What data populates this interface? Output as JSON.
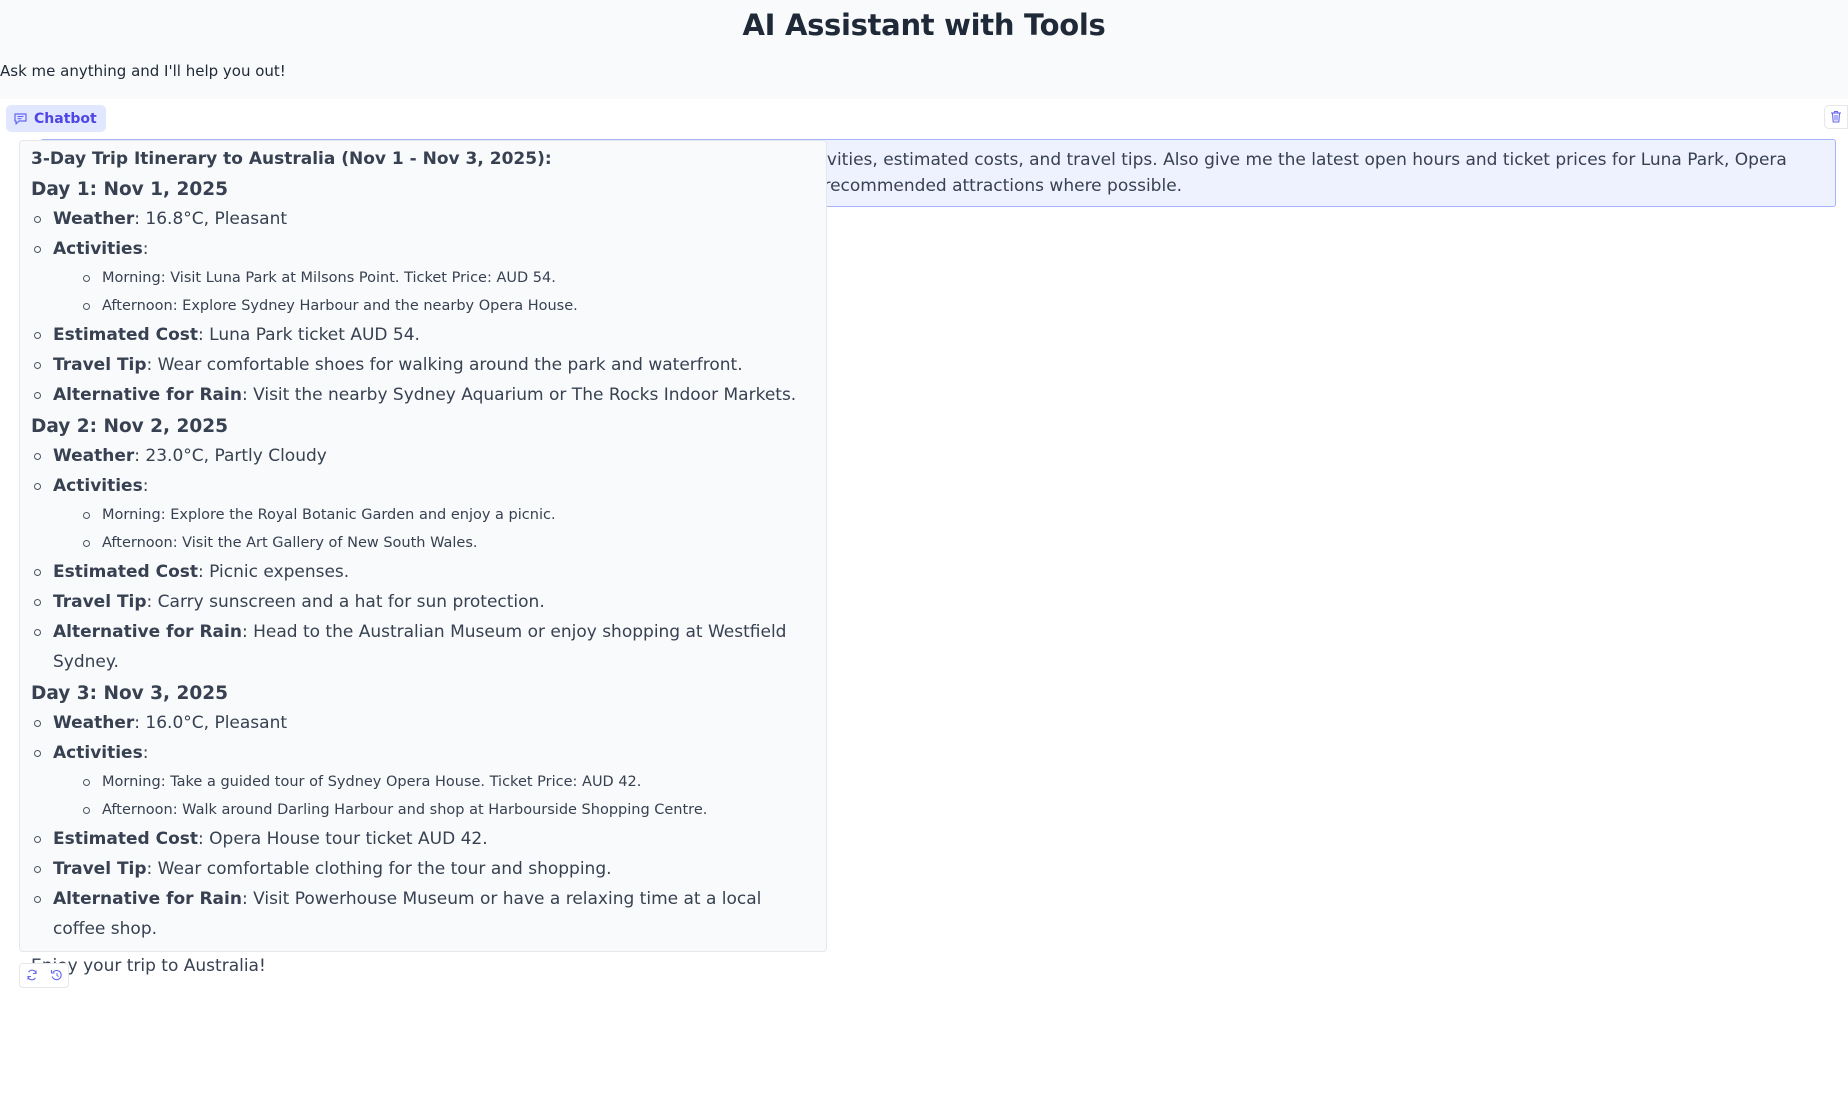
{
  "app": {
    "title": "AI Assistant with Tools",
    "subtitle": "Ask me anything and I'll help you out!"
  },
  "chatbot": {
    "label": "Chatbot",
    "label_icon": "chat-icon",
    "clear_icon": "trash-icon",
    "accent_color": "#4f46e5"
  },
  "messages": {
    "user": {
      "text": "Plan me a 3-day trip to Australia (Nov 1 – Nov 3, 2025). Include day-wise itinerary with activities, estimated costs, and travel tips. Also give me the latest open hours and ticket prices for Luna Park, Opera House the expected weather during those dates, and suggest alternatives if it rains. Book recommended attractions where possible."
    },
    "bot": {
      "heading": "3-Day Trip Itinerary to Australia (Nov 1 - Nov 3, 2025):",
      "days": [
        {
          "title": "Day 1: Nov 1, 2025",
          "weather_label": "Weather",
          "weather": ": 16.8°C, Pleasant",
          "activities_label": "Activities",
          "activities_suffix": ":",
          "activities": [
            "Morning: Visit Luna Park at Milsons Point. Ticket Price: AUD 54.",
            "Afternoon: Explore Sydney Harbour and the nearby Opera House."
          ],
          "cost_label": "Estimated Cost",
          "cost": ": Luna Park ticket AUD 54.",
          "tip_label": "Travel Tip",
          "tip": ": Wear comfortable shoes for walking around the park and waterfront.",
          "rain_label": "Alternative for Rain",
          "rain": ": Visit the nearby Sydney Aquarium or The Rocks Indoor Markets."
        },
        {
          "title": "Day 2: Nov 2, 2025",
          "weather_label": "Weather",
          "weather": ": 23.0°C, Partly Cloudy",
          "activities_label": "Activities",
          "activities_suffix": ":",
          "activities": [
            "Morning: Explore the Royal Botanic Garden and enjoy a picnic.",
            "Afternoon: Visit the Art Gallery of New South Wales."
          ],
          "cost_label": "Estimated Cost",
          "cost": ": Picnic expenses.",
          "tip_label": "Travel Tip",
          "tip": ": Carry sunscreen and a hat for sun protection.",
          "rain_label": "Alternative for Rain",
          "rain": ": Head to the Australian Museum or enjoy shopping at Westfield Sydney."
        },
        {
          "title": "Day 3: Nov 3, 2025",
          "weather_label": "Weather",
          "weather": ": 16.0°C, Pleasant",
          "activities_label": "Activities",
          "activities_suffix": ":",
          "activities": [
            "Morning: Take a guided tour of Sydney Opera House. Ticket Price: AUD 42.",
            "Afternoon: Walk around Darling Harbour and shop at Harbourside Shopping Centre."
          ],
          "cost_label": "Estimated Cost",
          "cost": ": Opera House tour ticket AUD 42.",
          "tip_label": "Travel Tip",
          "tip": ": Wear comfortable clothing for the tour and shopping.",
          "rain_label": "Alternative for Rain",
          "rain": ": Visit Powerhouse Museum or have a relaxing time at a local coffee shop."
        }
      ],
      "closing": "Enjoy your trip to Australia!"
    }
  },
  "actions": {
    "retry_icon": "retry-icon",
    "undo_icon": "undo-icon"
  }
}
